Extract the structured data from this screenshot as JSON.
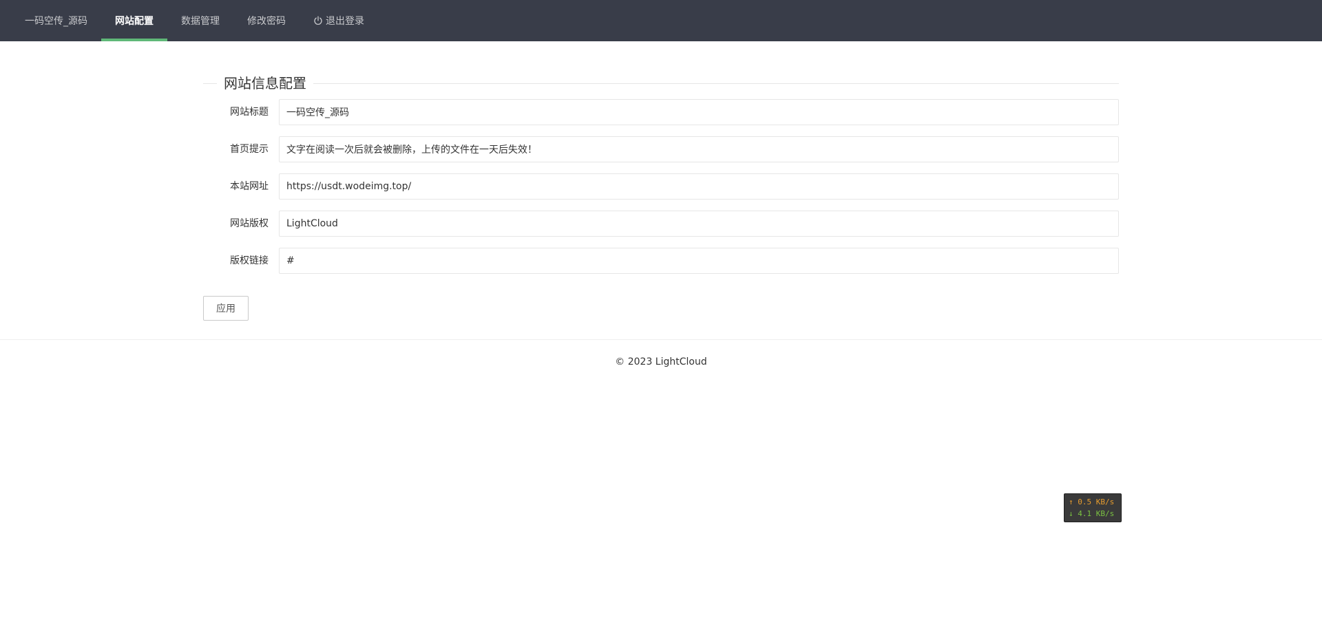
{
  "nav": {
    "brand": "一码空传_源码",
    "items": [
      {
        "label": "网站配置",
        "active": true
      },
      {
        "label": "数据管理",
        "active": false
      },
      {
        "label": "修改密码",
        "active": false
      }
    ],
    "logout_label": "退出登录",
    "logout_icon": "power-icon",
    "accent_color": "#5fb878",
    "bg_color": "#393d49"
  },
  "form": {
    "legend": "网站信息配置",
    "fields": [
      {
        "label": "网站标题",
        "value": "一码空传_源码"
      },
      {
        "label": "首页提示",
        "value": "文字在阅读一次后就会被删除，上传的文件在一天后失效！"
      },
      {
        "label": "本站网址",
        "value": "https://usdt.wodeimg.top/"
      },
      {
        "label": "网站版权",
        "value": "LightCloud"
      },
      {
        "label": "版权链接",
        "value": "#"
      }
    ],
    "apply_label": "应用"
  },
  "footer": {
    "text": "© 2023 LightCloud"
  },
  "speed_widget": {
    "upload": "↑ 0.5 KB/s",
    "download": "↓ 4.1 KB/s"
  }
}
